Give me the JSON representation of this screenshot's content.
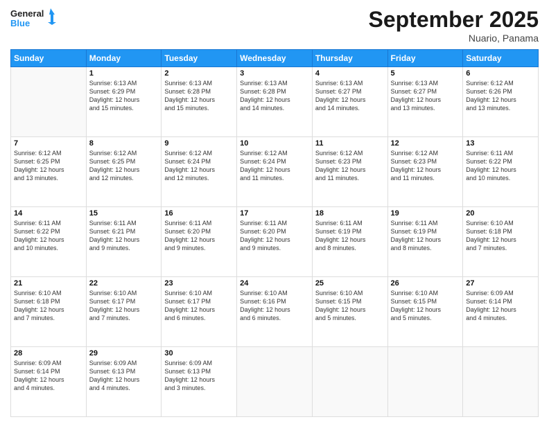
{
  "header": {
    "logo_line1": "General",
    "logo_line2": "Blue",
    "month": "September 2025",
    "location": "Nuario, Panama"
  },
  "days_of_week": [
    "Sunday",
    "Monday",
    "Tuesday",
    "Wednesday",
    "Thursday",
    "Friday",
    "Saturday"
  ],
  "weeks": [
    [
      {
        "day": "",
        "info": ""
      },
      {
        "day": "1",
        "info": "Sunrise: 6:13 AM\nSunset: 6:29 PM\nDaylight: 12 hours\nand 15 minutes."
      },
      {
        "day": "2",
        "info": "Sunrise: 6:13 AM\nSunset: 6:28 PM\nDaylight: 12 hours\nand 15 minutes."
      },
      {
        "day": "3",
        "info": "Sunrise: 6:13 AM\nSunset: 6:28 PM\nDaylight: 12 hours\nand 14 minutes."
      },
      {
        "day": "4",
        "info": "Sunrise: 6:13 AM\nSunset: 6:27 PM\nDaylight: 12 hours\nand 14 minutes."
      },
      {
        "day": "5",
        "info": "Sunrise: 6:13 AM\nSunset: 6:27 PM\nDaylight: 12 hours\nand 13 minutes."
      },
      {
        "day": "6",
        "info": "Sunrise: 6:12 AM\nSunset: 6:26 PM\nDaylight: 12 hours\nand 13 minutes."
      }
    ],
    [
      {
        "day": "7",
        "info": "Sunrise: 6:12 AM\nSunset: 6:25 PM\nDaylight: 12 hours\nand 13 minutes."
      },
      {
        "day": "8",
        "info": "Sunrise: 6:12 AM\nSunset: 6:25 PM\nDaylight: 12 hours\nand 12 minutes."
      },
      {
        "day": "9",
        "info": "Sunrise: 6:12 AM\nSunset: 6:24 PM\nDaylight: 12 hours\nand 12 minutes."
      },
      {
        "day": "10",
        "info": "Sunrise: 6:12 AM\nSunset: 6:24 PM\nDaylight: 12 hours\nand 11 minutes."
      },
      {
        "day": "11",
        "info": "Sunrise: 6:12 AM\nSunset: 6:23 PM\nDaylight: 12 hours\nand 11 minutes."
      },
      {
        "day": "12",
        "info": "Sunrise: 6:12 AM\nSunset: 6:23 PM\nDaylight: 12 hours\nand 11 minutes."
      },
      {
        "day": "13",
        "info": "Sunrise: 6:11 AM\nSunset: 6:22 PM\nDaylight: 12 hours\nand 10 minutes."
      }
    ],
    [
      {
        "day": "14",
        "info": "Sunrise: 6:11 AM\nSunset: 6:22 PM\nDaylight: 12 hours\nand 10 minutes."
      },
      {
        "day": "15",
        "info": "Sunrise: 6:11 AM\nSunset: 6:21 PM\nDaylight: 12 hours\nand 9 minutes."
      },
      {
        "day": "16",
        "info": "Sunrise: 6:11 AM\nSunset: 6:20 PM\nDaylight: 12 hours\nand 9 minutes."
      },
      {
        "day": "17",
        "info": "Sunrise: 6:11 AM\nSunset: 6:20 PM\nDaylight: 12 hours\nand 9 minutes."
      },
      {
        "day": "18",
        "info": "Sunrise: 6:11 AM\nSunset: 6:19 PM\nDaylight: 12 hours\nand 8 minutes."
      },
      {
        "day": "19",
        "info": "Sunrise: 6:11 AM\nSunset: 6:19 PM\nDaylight: 12 hours\nand 8 minutes."
      },
      {
        "day": "20",
        "info": "Sunrise: 6:10 AM\nSunset: 6:18 PM\nDaylight: 12 hours\nand 7 minutes."
      }
    ],
    [
      {
        "day": "21",
        "info": "Sunrise: 6:10 AM\nSunset: 6:18 PM\nDaylight: 12 hours\nand 7 minutes."
      },
      {
        "day": "22",
        "info": "Sunrise: 6:10 AM\nSunset: 6:17 PM\nDaylight: 12 hours\nand 7 minutes."
      },
      {
        "day": "23",
        "info": "Sunrise: 6:10 AM\nSunset: 6:17 PM\nDaylight: 12 hours\nand 6 minutes."
      },
      {
        "day": "24",
        "info": "Sunrise: 6:10 AM\nSunset: 6:16 PM\nDaylight: 12 hours\nand 6 minutes."
      },
      {
        "day": "25",
        "info": "Sunrise: 6:10 AM\nSunset: 6:15 PM\nDaylight: 12 hours\nand 5 minutes."
      },
      {
        "day": "26",
        "info": "Sunrise: 6:10 AM\nSunset: 6:15 PM\nDaylight: 12 hours\nand 5 minutes."
      },
      {
        "day": "27",
        "info": "Sunrise: 6:09 AM\nSunset: 6:14 PM\nDaylight: 12 hours\nand 4 minutes."
      }
    ],
    [
      {
        "day": "28",
        "info": "Sunrise: 6:09 AM\nSunset: 6:14 PM\nDaylight: 12 hours\nand 4 minutes."
      },
      {
        "day": "29",
        "info": "Sunrise: 6:09 AM\nSunset: 6:13 PM\nDaylight: 12 hours\nand 4 minutes."
      },
      {
        "day": "30",
        "info": "Sunrise: 6:09 AM\nSunset: 6:13 PM\nDaylight: 12 hours\nand 3 minutes."
      },
      {
        "day": "",
        "info": ""
      },
      {
        "day": "",
        "info": ""
      },
      {
        "day": "",
        "info": ""
      },
      {
        "day": "",
        "info": ""
      }
    ]
  ]
}
